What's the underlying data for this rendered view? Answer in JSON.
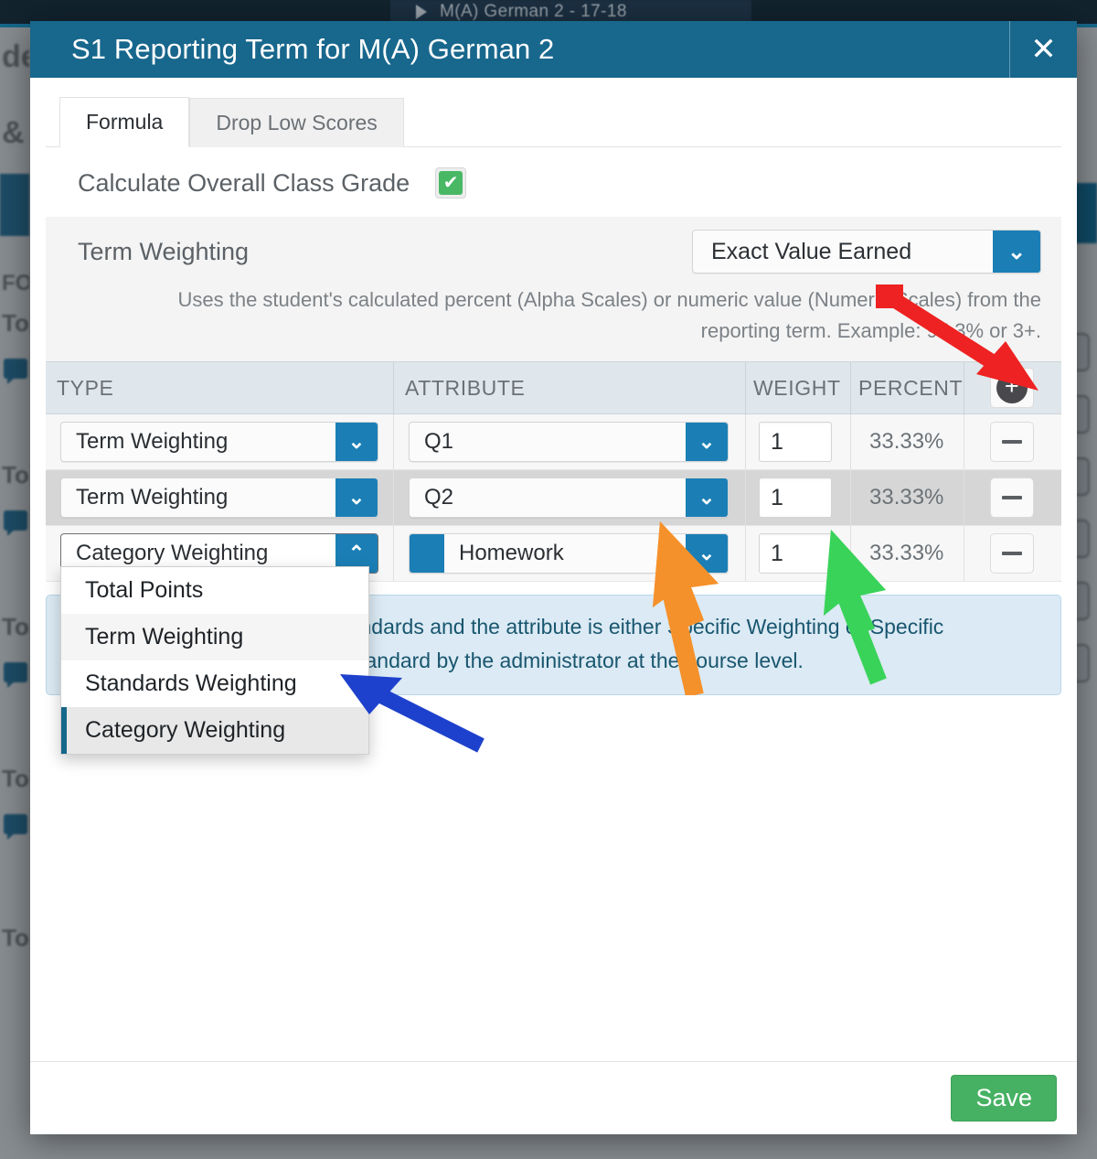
{
  "background": {
    "breadcrumb": "M(A) German 2  -  17-18",
    "left_labels": [
      "de",
      "& P",
      "FOR",
      "Tota",
      "Tota",
      "Tota",
      "Tota",
      "Total Points"
    ]
  },
  "modal": {
    "title": "S1 Reporting Term for M(A) German 2",
    "close_label": "✕",
    "close_icon": "close-icon",
    "tabs": [
      {
        "label": "Formula",
        "active": true
      },
      {
        "label": "Drop Low Scores",
        "active": false
      }
    ],
    "overall": {
      "label": "Calculate Overall Class Grade",
      "checked": true,
      "check_glyph": "✔"
    },
    "term_weighting": {
      "label": "Term Weighting",
      "selected": "Exact Value Earned",
      "chevron_icon": "chevron-down-icon",
      "description": "Uses the student's calculated percent (Alpha Scales) or numeric value (Numeric Scales) from the reporting term. Example: 95.3% or 3+."
    },
    "table": {
      "headers": {
        "type": "TYPE",
        "attribute": "ATTRIBUTE",
        "weight": "WEIGHT",
        "percent": "PERCENT"
      },
      "add_icon": "plus-icon",
      "remove_icon": "minus-icon",
      "rows": [
        {
          "type": "Term Weighting",
          "attribute": "Q1",
          "attribute_color": null,
          "weight": "1",
          "percent": "33.33%",
          "type_open": false
        },
        {
          "type": "Term Weighting",
          "attribute": "Q2",
          "attribute_color": null,
          "weight": "1",
          "percent": "33.33%",
          "type_open": false
        },
        {
          "type": "Category Weighting",
          "attribute": "Homework",
          "attribute_color": "#1b7fb5",
          "weight": "1",
          "percent": "33.33%",
          "type_open": true
        }
      ]
    },
    "type_menu": {
      "options": [
        {
          "label": "Total Points",
          "selected": false
        },
        {
          "label": "Term Weighting",
          "selected": false
        },
        {
          "label": "Standards Weighting",
          "selected": false
        },
        {
          "label": "Category Weighting",
          "selected": true
        }
      ]
    },
    "info_box": {
      "text": "Only available if the type is Standards and the attribute is either Specific Weighting or Specific Weighting is defined for each standard by the administrator at the course level."
    },
    "footer": {
      "save_label": "Save"
    }
  },
  "annotations": {
    "red_arrow": {
      "color": "#ee2222",
      "points_to": "plus-icon"
    },
    "orange_arrow": {
      "color": "#f5912b",
      "points_to": "attribute-dropdown-row-3"
    },
    "green_arrow": {
      "color": "#3ad35a",
      "points_to": "weight-input-row-3"
    },
    "blue_arrow": {
      "color": "#1d41cc",
      "points_to": "type-dropdown-menu"
    }
  },
  "colors": {
    "header_blue": "#18678d",
    "accent_blue": "#1b7fb5",
    "save_green": "#46b163",
    "check_green": "#49b865",
    "info_bg": "#dbeaf4",
    "info_text": "#19566f"
  }
}
